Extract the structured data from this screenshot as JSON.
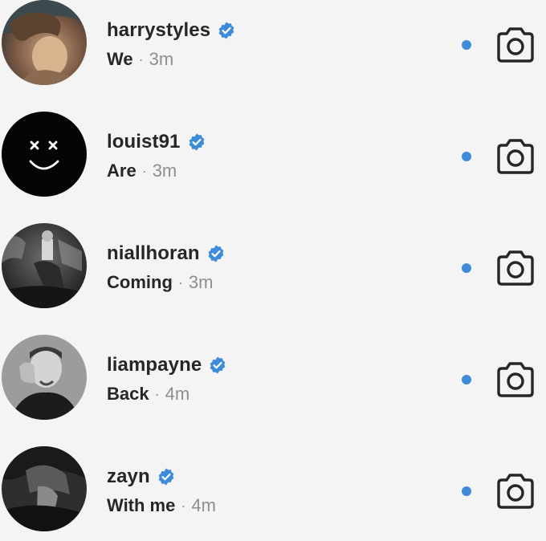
{
  "threads": [
    {
      "username": "harrystyles",
      "verified": true,
      "preview": "We",
      "time": "3m",
      "separator": "·",
      "unread": true,
      "avatar": "harry-avatar"
    },
    {
      "username": "louist91",
      "verified": true,
      "preview": "Are",
      "time": "3m",
      "separator": "·",
      "unread": true,
      "avatar": "louis-smiley-avatar"
    },
    {
      "username": "niallhoran",
      "verified": true,
      "preview": "Coming",
      "time": "3m",
      "separator": "·",
      "unread": true,
      "avatar": "niall-stage-avatar"
    },
    {
      "username": "liampayne",
      "verified": true,
      "preview": "Back",
      "time": "4m",
      "separator": "·",
      "unread": true,
      "avatar": "liam-avatar"
    },
    {
      "username": "zayn",
      "verified": true,
      "preview": "With me",
      "time": "4m",
      "separator": "·",
      "unread": true,
      "avatar": "zayn-avatar"
    }
  ],
  "colors": {
    "unread_dot": "#3e8bd9",
    "verified_badge": "#3e8bd9",
    "text_primary": "#262626",
    "text_secondary": "#8e8e8e",
    "background": "#f4f4f4"
  },
  "icons": {
    "verified": "verified-badge-icon",
    "camera": "camera-icon",
    "unread": "unread-dot"
  }
}
